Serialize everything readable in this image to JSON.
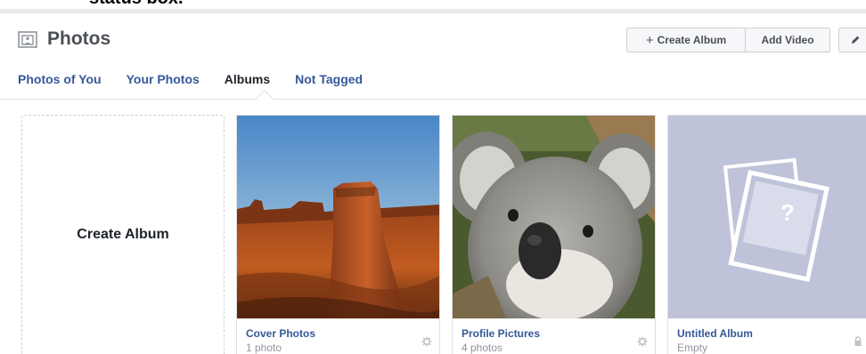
{
  "top_caption": "status box.",
  "header": {
    "title": "Photos",
    "create_album_label": "Create Album",
    "create_album_plus": "+",
    "add_video_label": "Add Video"
  },
  "tabs": [
    {
      "label": "Photos of You",
      "active": false
    },
    {
      "label": "Your Photos",
      "active": false
    },
    {
      "label": "Albums",
      "active": true
    },
    {
      "label": "Not Tagged",
      "active": false
    }
  ],
  "create_card": {
    "label": "Create Album"
  },
  "albums": [
    {
      "name": "Cover Photos",
      "count": "1 photo",
      "icon": "gear-icon"
    },
    {
      "name": "Profile Pictures",
      "count": "4 photos",
      "icon": "gear-icon"
    },
    {
      "name": "Untitled Album",
      "count": "Empty",
      "icon": "lock-icon",
      "placeholder_glyph": "?"
    }
  ],
  "colors": {
    "link": "#365899",
    "text_dark": "#1d2129",
    "muted": "#90949c",
    "placeholder_bg": "#bec3d9"
  }
}
